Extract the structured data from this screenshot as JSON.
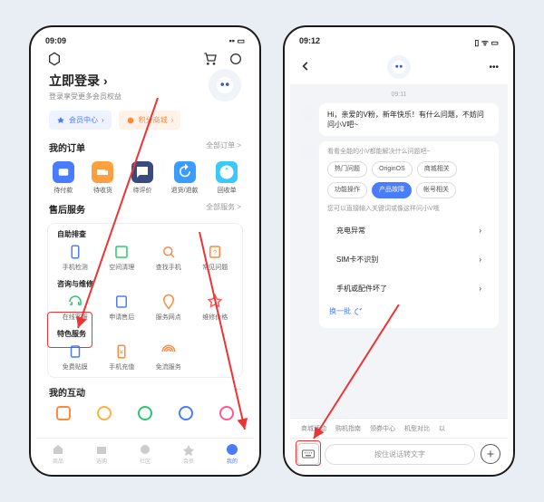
{
  "left": {
    "status_time": "09:09",
    "title": "立即登录",
    "subtitle": "登录享受更多会员权益",
    "pills": {
      "member": "会员中心",
      "points": "积分商城"
    },
    "orders": {
      "title": "我的订单",
      "more": "全部订单 >",
      "items": [
        "待付款",
        "待收货",
        "待评价",
        "退货/退款",
        "回收单"
      ]
    },
    "service": {
      "title": "售后服务",
      "more": "全部服务 >",
      "group1": {
        "title": "自助排查",
        "items": [
          "手机检测",
          "空间清理",
          "查找手机",
          "常见问题"
        ]
      },
      "group2": {
        "title": "咨询与维修",
        "items": [
          "在线客服",
          "申请售后",
          "服务网点",
          "维修价格"
        ]
      },
      "group3": {
        "title": "特色服务",
        "items": [
          "免费贴膜",
          "手机充值",
          "免流服务"
        ]
      }
    },
    "interact": {
      "title": "我的互动",
      "more": "···"
    },
    "nav": [
      "商品",
      "选购",
      "社区",
      "会员",
      "我的"
    ]
  },
  "right": {
    "status_time": "09:12",
    "ts": "09:11",
    "greeting": "Hi，亲爱的V粉，新年快乐！有什么问题，不妨问问小V吧~",
    "hint1": "看看全能的小V都能解决什么问题吧~",
    "chips": [
      "热门问题",
      "OriginOS",
      "商城相关",
      "功能操作",
      "产品故障",
      "帐号相关"
    ],
    "hint2": "您可以直接输入关键词或像这样问小V哦",
    "list": [
      "充电异常",
      "SIM卡不识别",
      "手机或配件坏了"
    ],
    "refresh": "换一批",
    "tabs": [
      "商城活动",
      "购机指南",
      "领券中心",
      "机型对比",
      "以"
    ],
    "input_placeholder": "按住说话转文字"
  }
}
